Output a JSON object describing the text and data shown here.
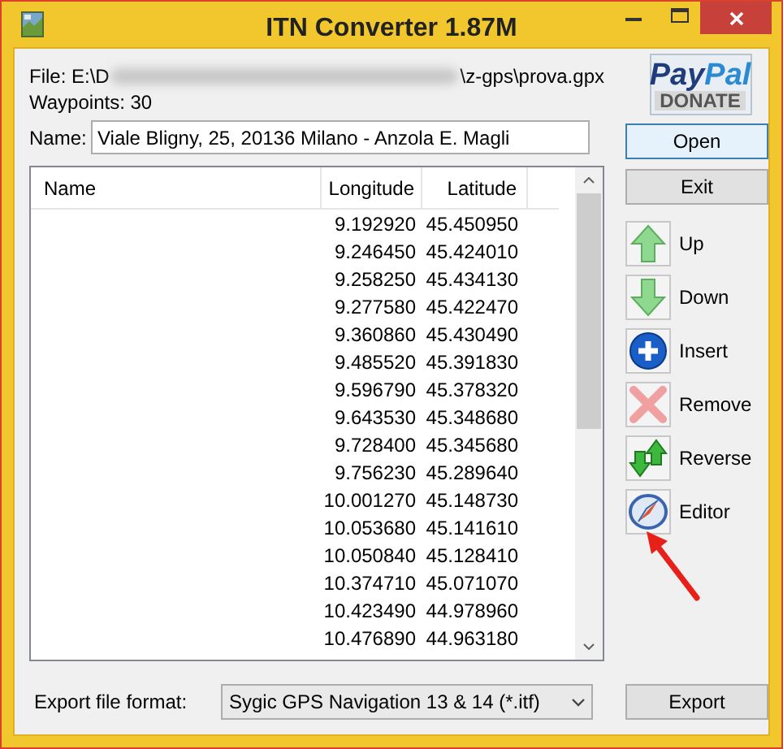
{
  "window": {
    "title": "ITN Converter 1.87M"
  },
  "file": {
    "start": "File: E:\\D",
    "end": "\\z-gps\\prova.gpx"
  },
  "waypoints": "Waypoints: 30",
  "name_field": {
    "label": "Name:",
    "value": "Viale Bligny, 25, 20136 Milano - Anzola E. Magli"
  },
  "donate": {
    "pay": "Pay",
    "pal": "Pal",
    "action": "DONATE"
  },
  "buttons": [
    "Open",
    "Exit"
  ],
  "tools": [
    {
      "kind": "up",
      "label": "Up"
    },
    {
      "kind": "down",
      "label": "Down"
    },
    {
      "kind": "insert",
      "label": "Insert"
    },
    {
      "kind": "remove",
      "label": "Remove"
    },
    {
      "kind": "reverse",
      "label": "Reverse"
    },
    {
      "kind": "editor",
      "label": "Editor"
    }
  ],
  "table": {
    "columns": [
      "Name",
      "Longitude",
      "Latitude"
    ],
    "rows": [
      {
        "longitude": "9.192920",
        "latitude": "45.450950"
      },
      {
        "longitude": "9.246450",
        "latitude": "45.424010"
      },
      {
        "longitude": "9.258250",
        "latitude": "45.434130"
      },
      {
        "longitude": "9.277580",
        "latitude": "45.422470"
      },
      {
        "longitude": "9.360860",
        "latitude": "45.430490"
      },
      {
        "longitude": "9.485520",
        "latitude": "45.391830"
      },
      {
        "longitude": "9.596790",
        "latitude": "45.378320"
      },
      {
        "longitude": "9.643530",
        "latitude": "45.348680"
      },
      {
        "longitude": "9.728400",
        "latitude": "45.345680"
      },
      {
        "longitude": "9.756230",
        "latitude": "45.289640"
      },
      {
        "longitude": "10.001270",
        "latitude": "45.148730"
      },
      {
        "longitude": "10.053680",
        "latitude": "45.141610"
      },
      {
        "longitude": "10.050840",
        "latitude": "45.128410"
      },
      {
        "longitude": "10.374710",
        "latitude": "45.071070"
      },
      {
        "longitude": "10.423490",
        "latitude": "44.978960"
      },
      {
        "longitude": "10.476890",
        "latitude": "44.963180"
      }
    ]
  },
  "export": {
    "label": "Export file format:",
    "format": "Sygic GPS Navigation 13 & 14 (*.itf)",
    "button": "Export"
  }
}
